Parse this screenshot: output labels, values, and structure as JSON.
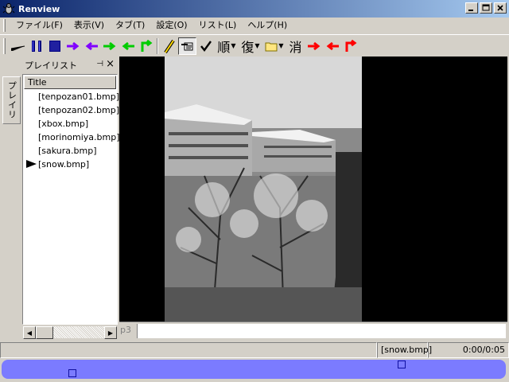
{
  "window": {
    "title": "Renview",
    "icon": "app-bug-icon",
    "buttons": [
      "minimize-icon",
      "maximize-icon",
      "close-icon"
    ]
  },
  "menu": [
    "ファイル(F)",
    "表示(V)",
    "タブ(T)",
    "設定(O)",
    "リスト(L)",
    "ヘルプ(H)"
  ],
  "toolbar": {
    "text_buttons": {
      "order": "順",
      "repeat": "復",
      "delete": "消"
    },
    "colors": {
      "dark_blue": "#000080",
      "purple": "#8000ff",
      "green": "#00cc00",
      "red": "#ff0000"
    }
  },
  "sidetab": {
    "label": "プレイリ"
  },
  "playlist": {
    "title": "プレイリスト",
    "column": "Title",
    "items": [
      "[tenpozan01.bmp]",
      "[tenpozan02.bmp]",
      "[xbox.bmp]",
      "[morinomiya.bmp]",
      "[sakura.bmp]",
      "[snow.bmp]"
    ],
    "current_index": 5
  },
  "viewer": {
    "tab_label": "p3"
  },
  "status": {
    "file": "[snow.bmp]",
    "time": "0:00/0:05"
  },
  "seek": {
    "position": 0.0,
    "accent": "#7b7bff"
  }
}
